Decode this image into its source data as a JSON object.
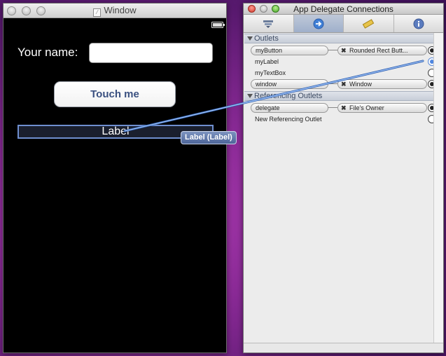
{
  "ib_window": {
    "title": "Window",
    "name_label": "Your name:",
    "name_field_value": "",
    "button_label": "Touch me",
    "label_text": "Label"
  },
  "inspector": {
    "title": "App Delegate Connections",
    "tabs": [
      {
        "icon": "attributes-icon",
        "active": false
      },
      {
        "icon": "connections-icon",
        "active": true
      },
      {
        "icon": "size-ruler-icon",
        "active": false
      },
      {
        "icon": "info-icon",
        "active": false
      }
    ],
    "outlets_header": "Outlets",
    "outlets": [
      {
        "name": "myButton",
        "target": "Rounded Rect Butt...",
        "state": "connected"
      },
      {
        "name": "myLabel",
        "target": "",
        "state": "dragging"
      },
      {
        "name": "myTextBox",
        "target": "",
        "state": "empty"
      },
      {
        "name": "window",
        "target": "Window",
        "state": "connected"
      }
    ],
    "referencing_header": "Referencing Outlets",
    "referencing": [
      {
        "name": "delegate",
        "target": "File's Owner",
        "state": "connected"
      },
      {
        "name": "New Referencing Outlet",
        "target": "",
        "state": "empty"
      }
    ]
  },
  "drag_tooltip": "Label (Label)",
  "colors": {
    "desktop": "#8a2a96",
    "link_line": "#7fa6e8",
    "tooltip": "#4d6599"
  }
}
